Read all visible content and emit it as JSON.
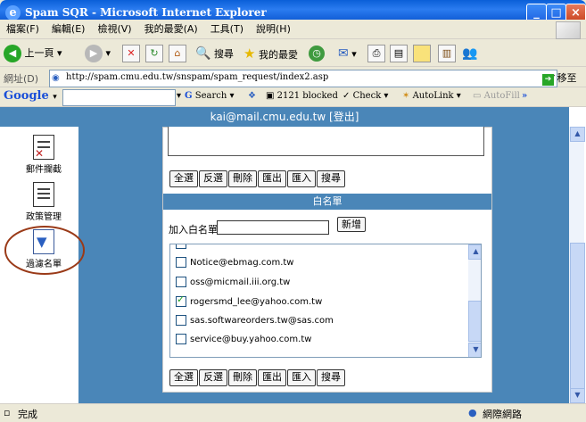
{
  "window": {
    "title": "Spam SQR - Microsoft Internet Explorer"
  },
  "menu": [
    "檔案(F)",
    "編輯(E)",
    "檢視(V)",
    "我的最愛(A)",
    "工具(T)",
    "說明(H)"
  ],
  "toolbar": {
    "back": "上一頁",
    "search": "搜尋",
    "favorites": "我的最愛"
  },
  "address": {
    "label": "網址(D)",
    "url": "http://spam.cmu.edu.tw/snspam/spam_request/index2.asp",
    "go": "移至"
  },
  "google": {
    "logo": "Google",
    "search": "Search",
    "blocked": "2121 blocked",
    "check": "Check",
    "autolink": "AutoLink",
    "autofill": "AutoFill"
  },
  "user": {
    "email": "kai@mail.cmu.edu.tw",
    "logout": "[登出]"
  },
  "nav": [
    "郵件攔截",
    "政策管理",
    "過濾名單"
  ],
  "buttons": [
    "全選",
    "反選",
    "刪除",
    "匯出",
    "匯入",
    "搜尋"
  ],
  "whitelist": {
    "header": "白名單",
    "add_label": "加入白名單",
    "add_button": "新增",
    "entries": [
      {
        "email": "Notice@ebmag.com.tw",
        "checked": false
      },
      {
        "email": "oss@micmail.iii.org.tw",
        "checked": false
      },
      {
        "email": "rogersmd_lee@yahoo.com.tw",
        "checked": true
      },
      {
        "email": "sas.softwareorders.tw@sas.com",
        "checked": false
      },
      {
        "email": "service@buy.yahoo.com.tw",
        "checked": false
      }
    ]
  },
  "status": {
    "done": "完成",
    "zone": "網際網路"
  }
}
